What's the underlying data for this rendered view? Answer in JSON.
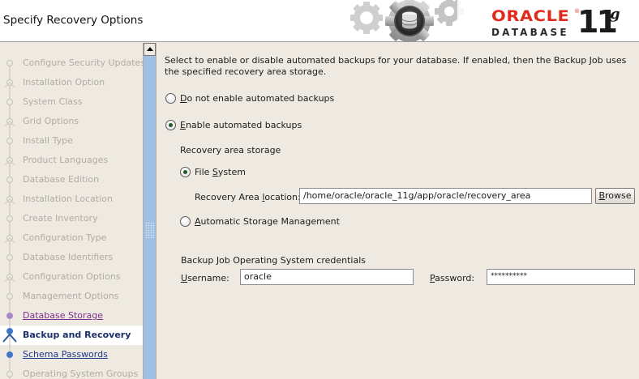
{
  "header": {
    "title": "Specify Recovery Options",
    "logo_oracle": "ORACLE",
    "logo_registered": "®",
    "logo_database": "DATABASE",
    "logo_version": "11",
    "logo_version_suffix": "g"
  },
  "steps": [
    {
      "label": "Configure Security Updates",
      "state": "done"
    },
    {
      "label": "Installation Option",
      "state": "done"
    },
    {
      "label": "System Class",
      "state": "done"
    },
    {
      "label": "Grid Options",
      "state": "done"
    },
    {
      "label": "Install Type",
      "state": "done"
    },
    {
      "label": "Product Languages",
      "state": "done"
    },
    {
      "label": "Database Edition",
      "state": "done"
    },
    {
      "label": "Installation Location",
      "state": "done"
    },
    {
      "label": "Create Inventory",
      "state": "done"
    },
    {
      "label": "Configuration Type",
      "state": "done"
    },
    {
      "label": "Database Identifiers",
      "state": "done"
    },
    {
      "label": "Configuration Options",
      "state": "done"
    },
    {
      "label": "Management Options",
      "state": "done"
    },
    {
      "label": "Database Storage",
      "state": "visited"
    },
    {
      "label": "Backup and Recovery",
      "state": "current"
    },
    {
      "label": "Schema Passwords",
      "state": "next"
    },
    {
      "label": "Operating System Groups",
      "state": "pending"
    }
  ],
  "main": {
    "intro": "Select to enable or disable automated backups for your database. If enabled, then the Backup Job uses the specified recovery area storage.",
    "option_disable": {
      "mnemonic": "D",
      "rest": "o not enable automated backups",
      "selected": false
    },
    "option_enable": {
      "mnemonic": "E",
      "rest": "nable automated backups",
      "selected": true
    },
    "storage_heading": "Recovery area storage",
    "storage_fs": {
      "pre": "File ",
      "mnemonic": "S",
      "post": "ystem",
      "selected": true
    },
    "location_label": {
      "pre": "Recovery Area ",
      "mnemonic": "l",
      "post": "ocation:"
    },
    "location_value": "/home/oracle/oracle_11g/app/oracle/recovery_area",
    "browse_label": {
      "mnemonic": "B",
      "rest": "rowse"
    },
    "storage_asm": {
      "mnemonic": "A",
      "rest": "utomatic Storage Management",
      "selected": false
    },
    "credentials_heading": "Backup Job Operating System credentials",
    "username_label": {
      "mnemonic": "U",
      "rest": "sername:"
    },
    "username_value": "oracle",
    "password_label": {
      "mnemonic": "P",
      "rest": "assword:"
    },
    "password_value": "**********"
  },
  "colors": {
    "background": "#eeeae2",
    "brand_red": "#e02a1d",
    "link_visited": "#7b2e8a",
    "link": "#1d3a8a",
    "scroll_track": "#9fc0e3"
  },
  "icons": [
    "gears-logo-icon",
    "step-done-icon",
    "step-visited-icon",
    "step-current-icon",
    "step-next-icon",
    "scroll-up-arrow-icon"
  ]
}
